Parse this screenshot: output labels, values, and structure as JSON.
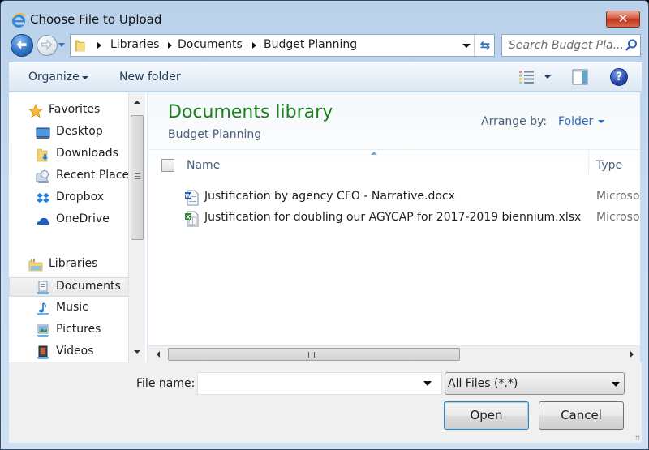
{
  "window": {
    "title": "Choose File to Upload",
    "close_label": "✕"
  },
  "nav": {
    "back_icon": "back-arrow-icon",
    "forward_icon": "forward-arrow-icon",
    "breadcrumbs": [
      "Libraries",
      "Documents",
      "Budget Planning"
    ],
    "refresh_icon": "refresh-icon",
    "refresh_glyph": "⇆"
  },
  "search": {
    "placeholder": "Search Budget Pla...",
    "value": ""
  },
  "toolbar": {
    "organize_label": "Organize",
    "new_folder_label": "New folder",
    "help_glyph": "?"
  },
  "sidebar": {
    "groups": [
      {
        "label": "Favorites",
        "icon": "star-icon",
        "items": [
          {
            "label": "Desktop",
            "icon": "desktop-icon"
          },
          {
            "label": "Downloads",
            "icon": "downloads-folder-icon"
          },
          {
            "label": "Recent Places",
            "icon": "recent-places-icon"
          },
          {
            "label": "Dropbox",
            "icon": "dropbox-icon"
          },
          {
            "label": "OneDrive",
            "icon": "onedrive-icon"
          }
        ]
      },
      {
        "label": "Libraries",
        "icon": "libraries-icon",
        "items": [
          {
            "label": "Documents",
            "icon": "documents-library-icon",
            "selected": true
          },
          {
            "label": "Music",
            "icon": "music-library-icon"
          },
          {
            "label": "Pictures",
            "icon": "pictures-library-icon"
          },
          {
            "label": "Videos",
            "icon": "videos-library-icon"
          }
        ]
      }
    ]
  },
  "content": {
    "library_title": "Documents library",
    "library_subtitle": "Budget Planning",
    "arrange_label": "Arrange by:",
    "arrange_value": "Folder",
    "columns": {
      "name": "Name",
      "type": "Type"
    },
    "files": [
      {
        "name": "Justification by agency CFO - Narrative.docx",
        "type": "Microsoft Word Document",
        "icon": "word-document-icon"
      },
      {
        "name": "Justification for doubling our AGYCAP for 2017-2019 biennium.xlsx",
        "type": "Microsoft Excel Worksheet",
        "icon": "excel-document-icon"
      }
    ]
  },
  "footer": {
    "file_name_label": "File name:",
    "file_name_value": "",
    "filter_value": "All Files (*.*)",
    "open_label": "Open",
    "cancel_label": "Cancel"
  },
  "colors": {
    "library_title": "#1b7f1b",
    "link_blue": "#2b6dc2",
    "close_red": "#c0391f",
    "chrome_blue": "#b9d1ea"
  }
}
